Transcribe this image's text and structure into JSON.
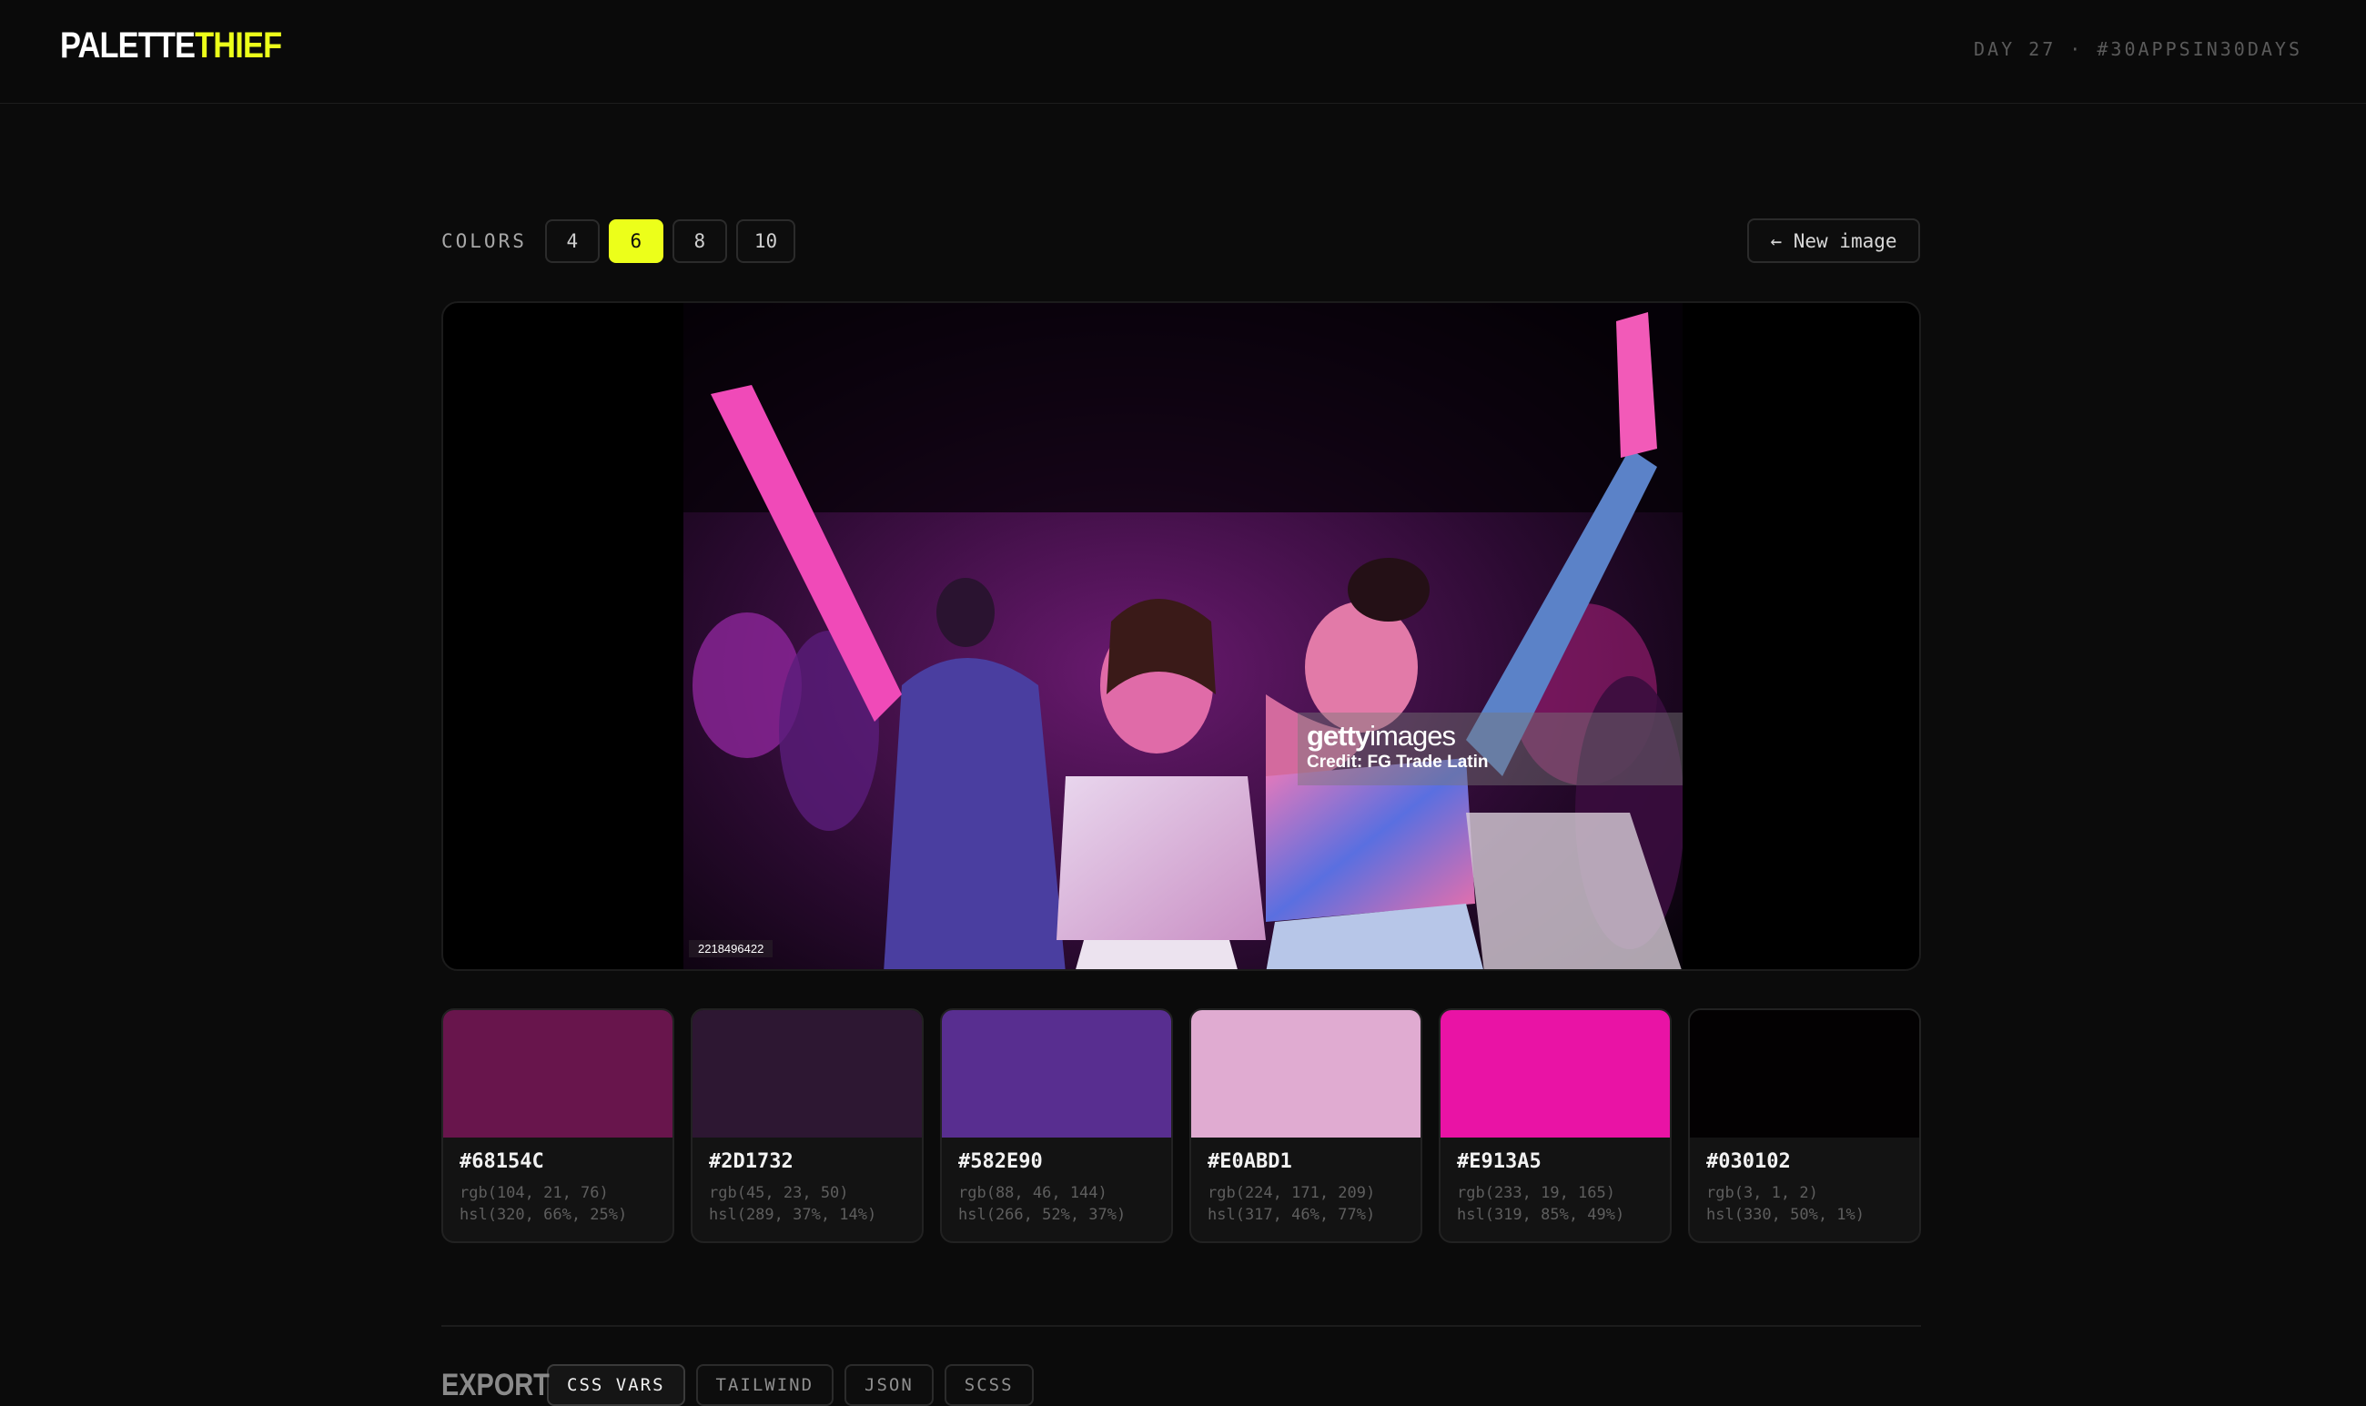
{
  "header": {
    "logo_part1": "PALETTE",
    "logo_part2": "THIEF",
    "day_tag": "DAY 27 · #30APPSIN30DAYS"
  },
  "controls": {
    "colors_label": "COLORS",
    "counts": [
      "4",
      "6",
      "8",
      "10"
    ],
    "selected_count": "6",
    "new_image_label": "← New image"
  },
  "image": {
    "watermark_brand_bold": "getty",
    "watermark_brand_light": "images",
    "watermark_credit": "Credit: FG Trade Latin",
    "image_id": "2218496422"
  },
  "swatches": [
    {
      "hex": "#68154C",
      "rgb": "rgb(104, 21, 76)",
      "hsl": "hsl(320, 66%, 25%)"
    },
    {
      "hex": "#2D1732",
      "rgb": "rgb(45, 23, 50)",
      "hsl": "hsl(289, 37%, 14%)"
    },
    {
      "hex": "#582E90",
      "rgb": "rgb(88, 46, 144)",
      "hsl": "hsl(266, 52%, 37%)"
    },
    {
      "hex": "#E0ABD1",
      "rgb": "rgb(224, 171, 209)",
      "hsl": "hsl(317, 46%, 77%)"
    },
    {
      "hex": "#E913A5",
      "rgb": "rgb(233, 19, 165)",
      "hsl": "hsl(319, 85%, 49%)"
    },
    {
      "hex": "#030102",
      "rgb": "rgb(3, 1, 2)",
      "hsl": "hsl(330, 50%, 1%)"
    }
  ],
  "export": {
    "title": "EXPORT",
    "tabs": [
      "CSS VARS",
      "TAILWIND",
      "JSON",
      "SCSS"
    ],
    "active_tab": "CSS VARS"
  },
  "colors": {
    "accent": "#ecff1a",
    "background": "#0b0b0b"
  }
}
